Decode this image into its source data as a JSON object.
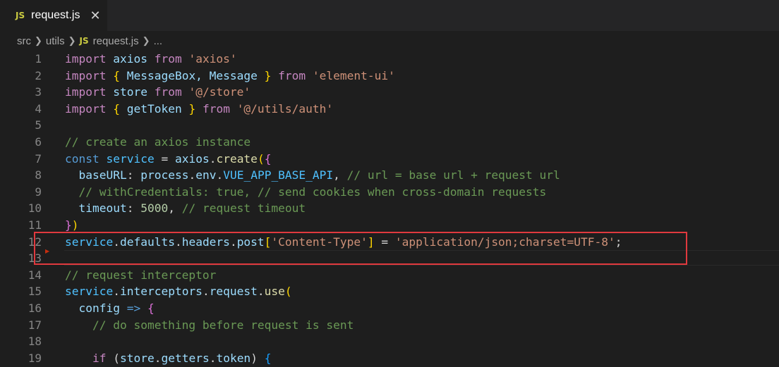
{
  "tab": {
    "badge": "JS",
    "title": "request.js"
  },
  "breadcrumb": {
    "folder1": "src",
    "folder2": "utils",
    "badge": "JS",
    "file": "request.js",
    "more": "..."
  },
  "lines": {
    "1": "1",
    "2": "2",
    "3": "3",
    "4": "4",
    "5": "5",
    "6": "6",
    "7": "7",
    "8": "8",
    "9": "9",
    "10": "10",
    "11": "11",
    "12": "12",
    "13": "13",
    "14": "14",
    "15": "15",
    "16": "16",
    "17": "17",
    "18": "18",
    "19": "19"
  },
  "code": {
    "l1": [
      "import",
      " axios ",
      "from",
      " ",
      "'axios'"
    ],
    "l2": [
      "import",
      " ",
      "{",
      " MessageBox, Message ",
      "}",
      " ",
      "from",
      " ",
      "'element-ui'"
    ],
    "l3": [
      "import",
      " store ",
      "from",
      " ",
      "'@/store'"
    ],
    "l4": [
      "import",
      " ",
      "{",
      " getToken ",
      "}",
      " ",
      "from",
      " ",
      "'@/utils/auth'"
    ],
    "l6": "// create an axios instance",
    "l7": [
      "const",
      " ",
      "service",
      " = ",
      "axios",
      ".",
      "create",
      "(",
      "{"
    ],
    "l8": [
      "  ",
      "baseURL",
      ": ",
      "process",
      ".",
      "env",
      ".",
      "VUE_APP_BASE_API",
      ", ",
      "// url = base url + request url"
    ],
    "l9": [
      "  ",
      "// withCredentials: true, // send cookies when cross-domain requests"
    ],
    "l10": [
      "  ",
      "timeout",
      ": ",
      "5000",
      ", ",
      "// request timeout"
    ],
    "l11": [
      "}",
      ")"
    ],
    "l12": [
      "service",
      ".",
      "defaults",
      ".",
      "headers",
      ".",
      "post",
      "[",
      "'Content-Type'",
      "]",
      " = ",
      "'application/json;charset=UTF-8'",
      ";"
    ],
    "l14": "// request interceptor",
    "l15": [
      "service",
      ".",
      "interceptors",
      ".",
      "request",
      ".",
      "use",
      "("
    ],
    "l16": [
      "  ",
      "config",
      " ",
      "=>",
      " ",
      "{"
    ],
    "l17": [
      "    ",
      "// do something before request is sent"
    ],
    "l19": [
      "    ",
      "if",
      " (",
      "store",
      ".",
      "getters",
      ".",
      "token",
      ") ",
      "{"
    ]
  },
  "colors": {
    "highlight_box": "#e0393e",
    "js_badge": "#cbcb41"
  }
}
